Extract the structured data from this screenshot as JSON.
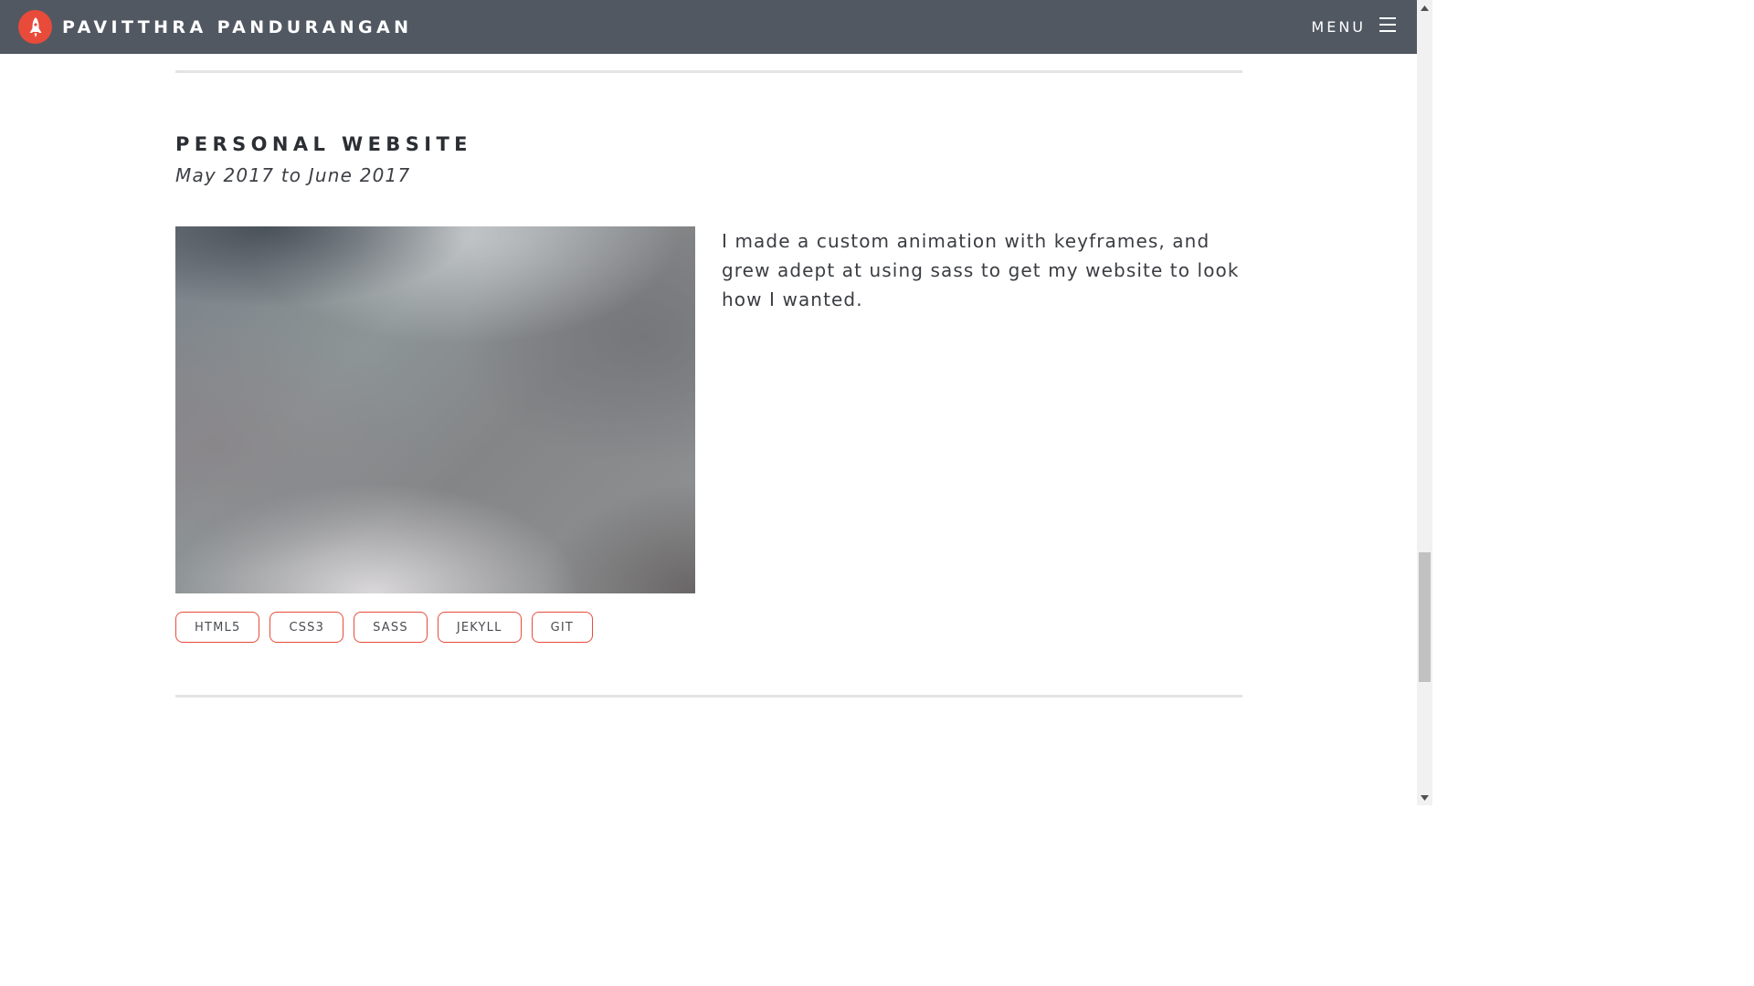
{
  "header": {
    "brand_name": "PAVITTHRA PANDURANGAN",
    "menu_label": "MENU"
  },
  "project": {
    "title": "PERSONAL WEBSITE",
    "dates": "May 2017 to June 2017",
    "description": "I made a custom animation with keyframes, and grew adept at using sass to get my website to look how I wanted.",
    "tags": [
      "HTML5",
      "CSS3",
      "SASS",
      "JEKYLL",
      "GIT"
    ]
  },
  "colors": {
    "navbar": "#515862",
    "accent": "#e84b3a",
    "text_dark": "#2b2e33",
    "divider": "#e4e4e4"
  },
  "icons": {
    "logo": "rocket-icon",
    "menu": "hamburger-icon"
  }
}
